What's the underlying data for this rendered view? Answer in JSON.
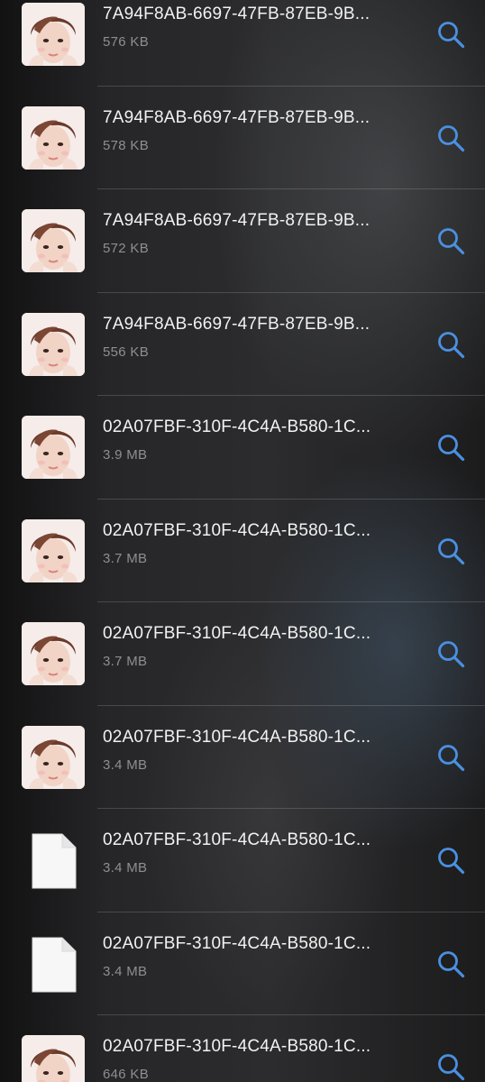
{
  "files": [
    {
      "name": "7A94F8AB-6697-47FB-87EB-9B...",
      "size": "576 KB",
      "thumbnail": "photo",
      "action_icon": "magnifying-glass-icon"
    },
    {
      "name": "7A94F8AB-6697-47FB-87EB-9B...",
      "size": "578 KB",
      "thumbnail": "photo",
      "action_icon": "magnifying-glass-icon"
    },
    {
      "name": "7A94F8AB-6697-47FB-87EB-9B...",
      "size": "572 KB",
      "thumbnail": "photo",
      "action_icon": "magnifying-glass-icon"
    },
    {
      "name": "7A94F8AB-6697-47FB-87EB-9B...",
      "size": "556 KB",
      "thumbnail": "photo",
      "action_icon": "magnifying-glass-icon"
    },
    {
      "name": "02A07FBF-310F-4C4A-B580-1C...",
      "size": "3.9 MB",
      "thumbnail": "photo",
      "action_icon": "magnifying-glass-icon"
    },
    {
      "name": "02A07FBF-310F-4C4A-B580-1C...",
      "size": "3.7 MB",
      "thumbnail": "photo",
      "action_icon": "magnifying-glass-icon"
    },
    {
      "name": "02A07FBF-310F-4C4A-B580-1C...",
      "size": "3.7 MB",
      "thumbnail": "photo",
      "action_icon": "magnifying-glass-icon"
    },
    {
      "name": "02A07FBF-310F-4C4A-B580-1C...",
      "size": "3.4 MB",
      "thumbnail": "photo",
      "action_icon": "magnifying-glass-icon"
    },
    {
      "name": "02A07FBF-310F-4C4A-B580-1C...",
      "size": "3.4 MB",
      "thumbnail": "document",
      "action_icon": "magnifying-glass-icon"
    },
    {
      "name": "02A07FBF-310F-4C4A-B580-1C...",
      "size": "3.4 MB",
      "thumbnail": "document",
      "action_icon": "magnifying-glass-icon"
    },
    {
      "name": "02A07FBF-310F-4C4A-B580-1C...",
      "size": "646 KB",
      "thumbnail": "photo",
      "action_icon": "magnifying-glass-icon"
    }
  ],
  "colors": {
    "accent": "#4a90e2",
    "primary_text": "#f2f2f2",
    "secondary_text": "#8e8e93",
    "separator": "#3a3a3c"
  }
}
